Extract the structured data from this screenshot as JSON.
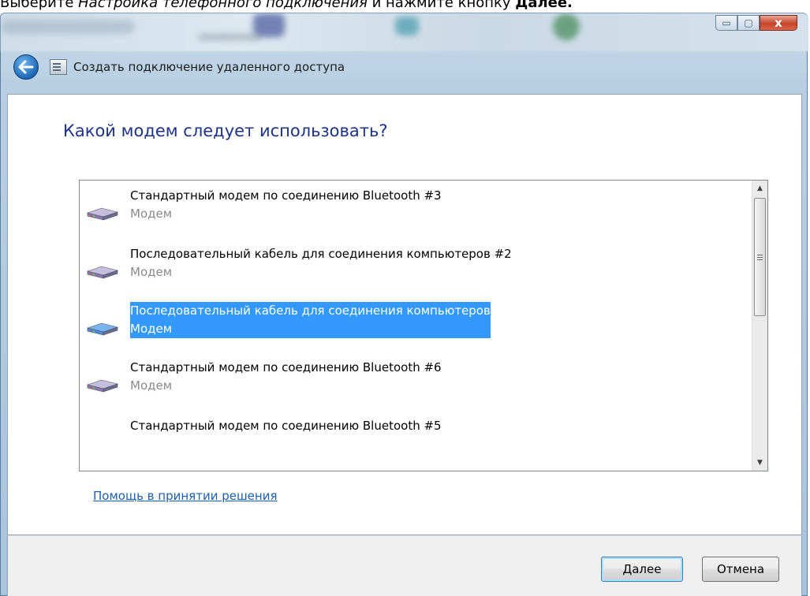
{
  "instruction": {
    "part1": "Выберите ",
    "part2": "Настройка телефонного подключения",
    "part3": " и нажмите кнопку ",
    "part4": "Далее."
  },
  "window": {
    "title": "Создать подключение удаленного доступа",
    "caption": {
      "minimize": "▭",
      "maximize": "▢",
      "close": "x"
    },
    "icons": [
      "back-arrow-icon",
      "wizard-window-icon",
      "modem-icon",
      "scroll-grip-icon"
    ]
  },
  "main": {
    "heading": "Какой модем следует использовать?",
    "list": [
      {
        "name": "Стандартный модем по соединению Bluetooth #3",
        "type": "Модем",
        "selected": false
      },
      {
        "name": "Последовательный кабель для соединения компьютеров #2",
        "type": "Модем",
        "selected": false
      },
      {
        "name": "Последовательный кабель для соединения компьютеров",
        "type": "Модем",
        "selected": true
      },
      {
        "name": "Стандартный модем по соединению Bluetooth #6",
        "type": "Модем",
        "selected": false
      },
      {
        "name": "Стандартный модем по соединению Bluetooth #5",
        "type": "",
        "selected": false
      }
    ],
    "help_link": "Помощь в принятии решения"
  },
  "footer": {
    "next_label": "Далее",
    "cancel_label": "Отмена"
  },
  "colors": {
    "heading": "#1e3287",
    "selection": "#3399ff",
    "link": "#1d5fb0"
  }
}
